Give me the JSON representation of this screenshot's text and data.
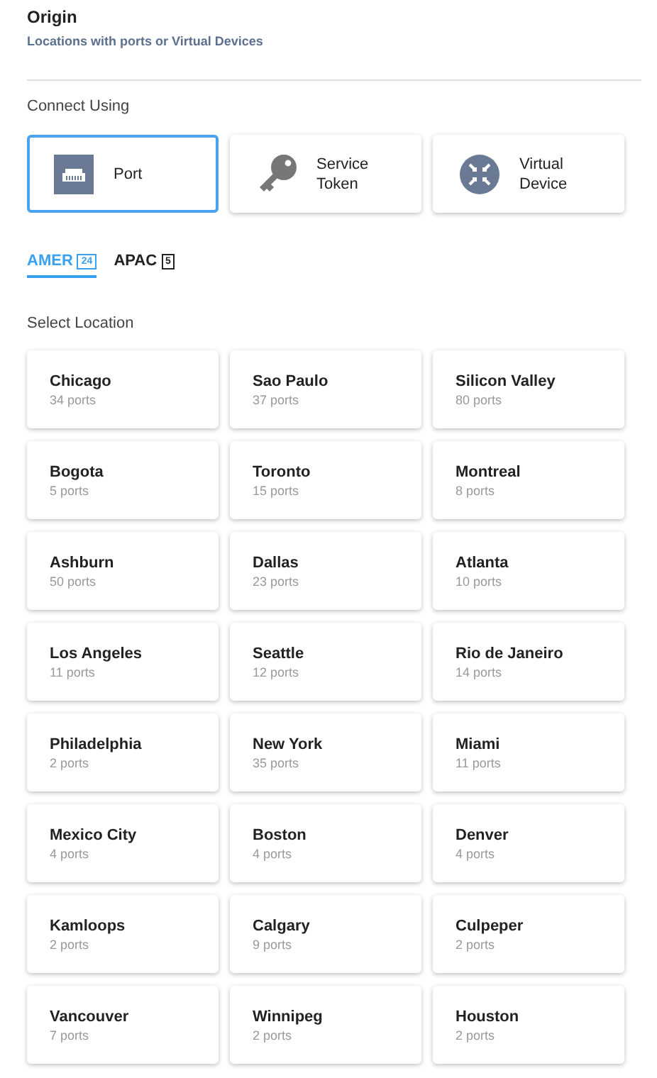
{
  "header": {
    "title": "Origin",
    "subtitle": "Locations with ports or Virtual Devices"
  },
  "connect": {
    "label": "Connect Using",
    "options": [
      {
        "kind": "port",
        "label": "Port",
        "selected": true
      },
      {
        "kind": "token",
        "label": "Service Token",
        "selected": false
      },
      {
        "kind": "device",
        "label": "Virtual Device",
        "selected": false
      }
    ]
  },
  "tabs": [
    {
      "label": "AMER",
      "count": "24",
      "selected": true
    },
    {
      "label": "APAC",
      "count": "5",
      "selected": false
    }
  ],
  "locations": {
    "label": "Select Location",
    "items": [
      {
        "name": "Chicago",
        "ports": "34 ports"
      },
      {
        "name": "Sao Paulo",
        "ports": "37 ports"
      },
      {
        "name": "Silicon Valley",
        "ports": "80 ports"
      },
      {
        "name": "Bogota",
        "ports": "5 ports"
      },
      {
        "name": "Toronto",
        "ports": "15 ports"
      },
      {
        "name": "Montreal",
        "ports": "8 ports"
      },
      {
        "name": "Ashburn",
        "ports": "50 ports"
      },
      {
        "name": "Dallas",
        "ports": "23 ports"
      },
      {
        "name": "Atlanta",
        "ports": "10 ports"
      },
      {
        "name": "Los Angeles",
        "ports": "11 ports"
      },
      {
        "name": "Seattle",
        "ports": "12 ports"
      },
      {
        "name": "Rio de Janeiro",
        "ports": "14 ports"
      },
      {
        "name": "Philadelphia",
        "ports": "2 ports"
      },
      {
        "name": "New York",
        "ports": "35 ports"
      },
      {
        "name": "Miami",
        "ports": "11 ports"
      },
      {
        "name": "Mexico City",
        "ports": "4 ports"
      },
      {
        "name": "Boston",
        "ports": "4 ports"
      },
      {
        "name": "Denver",
        "ports": "4 ports"
      },
      {
        "name": "Kamloops",
        "ports": "2 ports"
      },
      {
        "name": "Calgary",
        "ports": "9 ports"
      },
      {
        "name": "Culpeper",
        "ports": "2 ports"
      },
      {
        "name": "Vancouver",
        "ports": "7 ports"
      },
      {
        "name": "Winnipeg",
        "ports": "2 ports"
      },
      {
        "name": "Houston",
        "ports": "2 ports"
      }
    ]
  }
}
